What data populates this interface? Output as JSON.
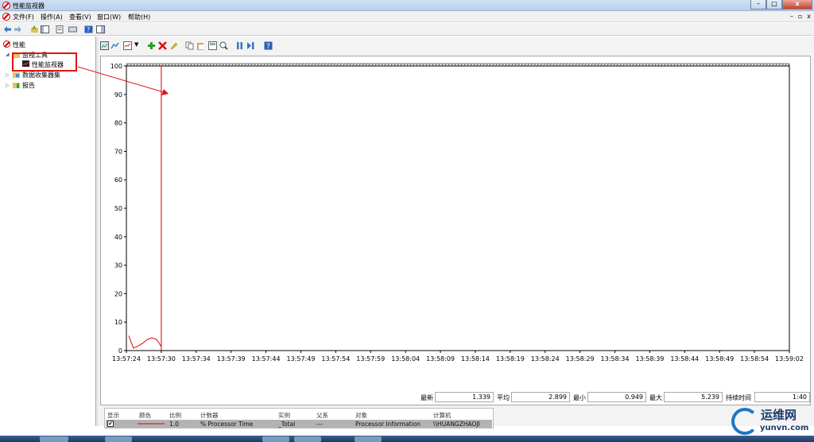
{
  "window": {
    "title": "性能监视器",
    "close_glyph": "x",
    "min_glyph": "–",
    "max_glyph": "□"
  },
  "menu": {
    "items": [
      "文件(F)",
      "操作(A)",
      "查看(V)",
      "窗口(W)",
      "帮助(H)"
    ],
    "mdi": [
      "–",
      "▫",
      "x"
    ]
  },
  "tree": {
    "root": "性能",
    "tools": "监视工具",
    "monitor": "性能监视器",
    "collectors": "数据收集器集",
    "reports": "报告"
  },
  "chart_data": {
    "type": "line",
    "ylim": [
      0,
      100
    ],
    "yticks": [
      "0",
      "10",
      "20",
      "30",
      "40",
      "50",
      "60",
      "70",
      "80",
      "90",
      "100"
    ],
    "xticks": [
      "13:57:24",
      "13:57:30",
      "13:57:34",
      "13:57:39",
      "13:57:44",
      "13:57:49",
      "13:57:54",
      "13:57:59",
      "13:58:04",
      "13:58:09",
      "13:58:14",
      "13:58:19",
      "13:58:24",
      "13:58:29",
      "13:58:34",
      "13:58:39",
      "13:58:44",
      "13:58:49",
      "13:58:54",
      "13:59:02"
    ],
    "series": [
      {
        "color": "#e00000",
        "values": [
          5.2,
          0.9,
          1.6,
          2.6,
          3.9,
          4.5,
          3.9,
          1.4
        ]
      }
    ],
    "current_time_marker": "13:57:30"
  },
  "stats": {
    "last_label": "最新",
    "last": "1.339",
    "avg_label": "平均",
    "avg": "2.899",
    "min_label": "最小",
    "min": "0.949",
    "max_label": "最大",
    "max": "5.239",
    "dur_label": "持续时间",
    "dur": "1:40"
  },
  "legend": {
    "headers": [
      "显示",
      "颜色",
      "比例",
      "计数器",
      "实例",
      "父系",
      "对象",
      "计算机"
    ],
    "row": {
      "check": "✔",
      "scale": "1.0",
      "counter": "% Processor Time",
      "instance": "_Total",
      "parent": "---",
      "object": "Processor Information",
      "computer": "\\\\HUANGZHAOJI"
    },
    "line_color": "#e00000"
  },
  "watermark": {
    "name": "运维网",
    "url": "yunvn.com"
  }
}
